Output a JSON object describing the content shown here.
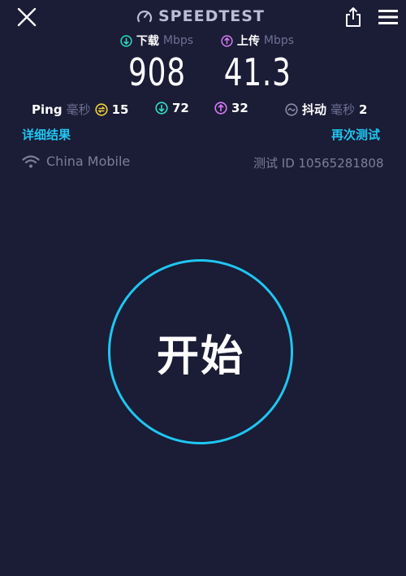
{
  "header": {
    "title": "SPEEDTEST",
    "icons": [
      "close-icon",
      "speedometer-icon",
      "share-icon",
      "menu-icon"
    ]
  },
  "download": {
    "label": "下载",
    "unit": "Mbps",
    "value": "908",
    "color": "#2de0c4"
  },
  "upload": {
    "label": "上传",
    "unit": "Mbps",
    "value": "41.3",
    "color": "#d67cf5"
  },
  "stats": {
    "ping_label": "Ping",
    "ping_unit": "毫秒",
    "ping_value": "15",
    "ping_color": "#f2d13a",
    "download_ping": "72",
    "upload_ping": "32",
    "jitter_label": "抖动",
    "jitter_unit": "毫秒",
    "jitter_value": "2"
  },
  "links": {
    "details": "详细结果",
    "retest": "再次测试"
  },
  "connection": {
    "isp": "China Mobile",
    "test_id": "测试 ID 10565281808"
  },
  "start": {
    "label": "开始",
    "ring_color": "#1fc6f2"
  },
  "colors": {
    "background": "#1b1c35",
    "accent": "#1fc6f2",
    "muted": "#6d7193"
  }
}
